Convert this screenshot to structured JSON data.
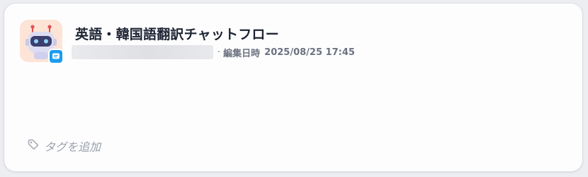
{
  "app": {
    "title": "英語・韓国語翻訳チャットフロー",
    "icon": "robot-icon",
    "type_badge_icon": "chat-bubble-icon",
    "badge_color": "#1b9cf0"
  },
  "meta": {
    "separator": "·",
    "edited_label": "編集日時",
    "edited_time": "2025/08/25 17:45"
  },
  "tags": {
    "add_label": "タグを追加",
    "icon": "tag-icon"
  }
}
